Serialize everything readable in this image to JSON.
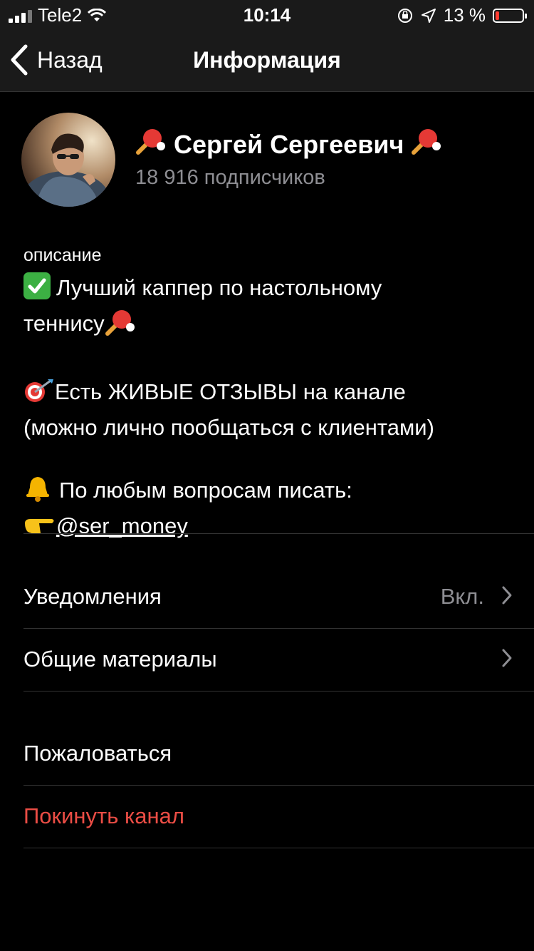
{
  "status_bar": {
    "carrier": "Tele2",
    "time": "10:14",
    "battery_percent_text": "13 %",
    "battery_level": 0.13
  },
  "nav": {
    "back_label": "Назад",
    "title": "Информация"
  },
  "profile": {
    "name": "Сергей Сергеевич",
    "subscribers": "18 916 подписчиков"
  },
  "description": {
    "label": "описание",
    "line1": "Лучший каппер по настольному",
    "line2": "теннису",
    "line3": "Есть ЖИВЫЕ ОТЗЫВЫ на канале",
    "line4": "(можно лично пообщаться с клиентами)",
    "line5": "По любым вопросам писать:",
    "mention": "@ser_money"
  },
  "settings": {
    "notifications_label": "Уведомления",
    "notifications_value": "Вкл.",
    "shared_media_label": "Общие материалы"
  },
  "actions": {
    "report_label": "Пожаловаться",
    "leave_label": "Покинуть канал"
  },
  "colors": {
    "background": "#000000",
    "bar": "#1a1a1a",
    "secondary_text": "#8e8e93",
    "destructive": "#eb4d45"
  }
}
